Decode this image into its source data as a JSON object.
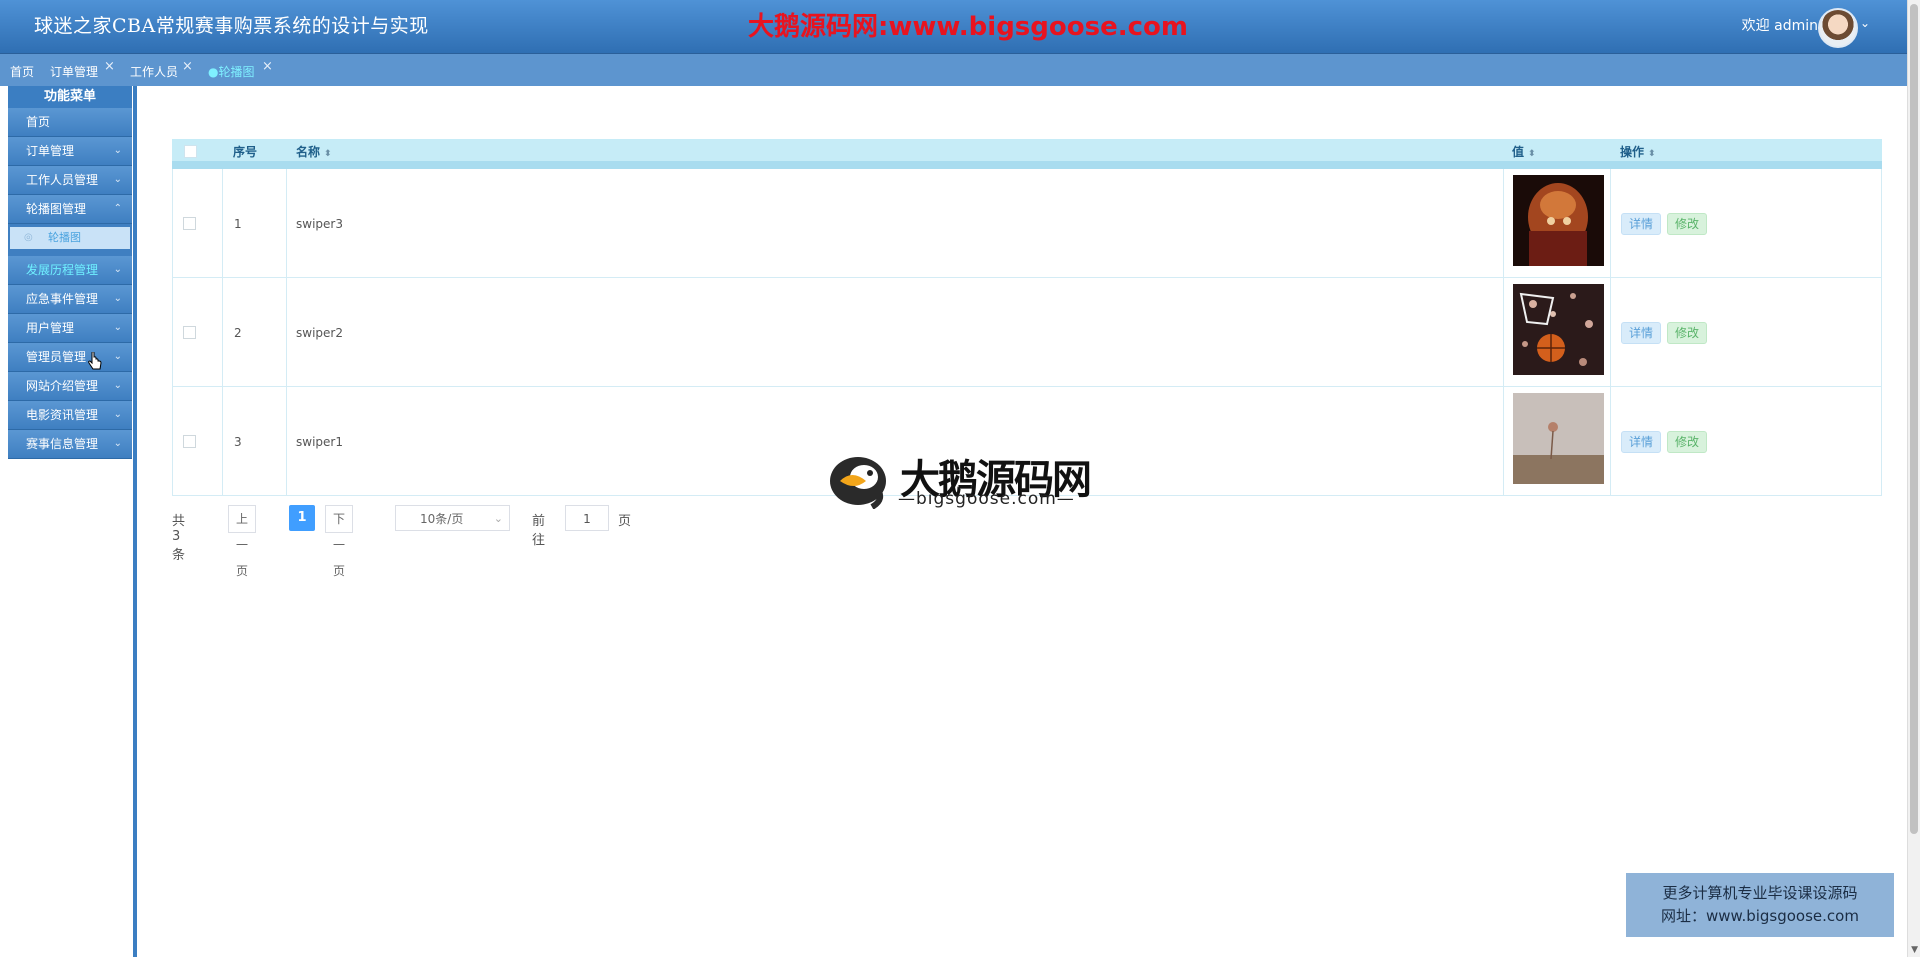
{
  "header": {
    "title": "球迷之家CBA常规赛事购票系统的设计与实现",
    "watermark": "大鹅源码网:www.bigsgoose.com",
    "welcome": "欢迎 admin"
  },
  "tabs": [
    {
      "label": "首页",
      "closable": false,
      "active": false
    },
    {
      "label": "订单管理",
      "closable": true,
      "active": false
    },
    {
      "label": "工作人员",
      "closable": true,
      "active": false
    },
    {
      "label": "●轮播图",
      "closable": true,
      "active": true
    }
  ],
  "sidebar": {
    "header": "功能菜单",
    "items": [
      {
        "label": "首页"
      },
      {
        "label": "订单管理"
      },
      {
        "label": "工作人员管理"
      },
      {
        "label": "轮播图管理"
      },
      {
        "label": "轮播图",
        "sub": true
      },
      {
        "label": "发展历程管理"
      },
      {
        "label": "应急事件管理"
      },
      {
        "label": "用户管理"
      },
      {
        "label": "管理员管理"
      },
      {
        "label": "网站介绍管理"
      },
      {
        "label": "电影资讯管理"
      },
      {
        "label": "赛事信息管理"
      }
    ]
  },
  "table": {
    "columns": {
      "index": "序号",
      "name": "名称",
      "value": "值",
      "action": "操作"
    },
    "rows": [
      {
        "index": "1",
        "name": "swiper3",
        "detail": "详情",
        "edit": "修改"
      },
      {
        "index": "2",
        "name": "swiper2",
        "detail": "详情",
        "edit": "修改"
      },
      {
        "index": "3",
        "name": "swiper1",
        "detail": "详情",
        "edit": "修改"
      }
    ]
  },
  "pagination": {
    "total": "共 3 条",
    "prev": "上一页",
    "current": "1",
    "next": "下一页",
    "page_size": "10条/页",
    "goto_label": "前往",
    "goto_value": "1",
    "page_suffix": "页"
  },
  "watermark_center": {
    "title": "大鹅源码网",
    "subtitle": "—bigsgoose.com—"
  },
  "ad": {
    "line1": "更多计算机专业毕设课设源码",
    "line2": "网址：www.bigsgoose.com"
  }
}
